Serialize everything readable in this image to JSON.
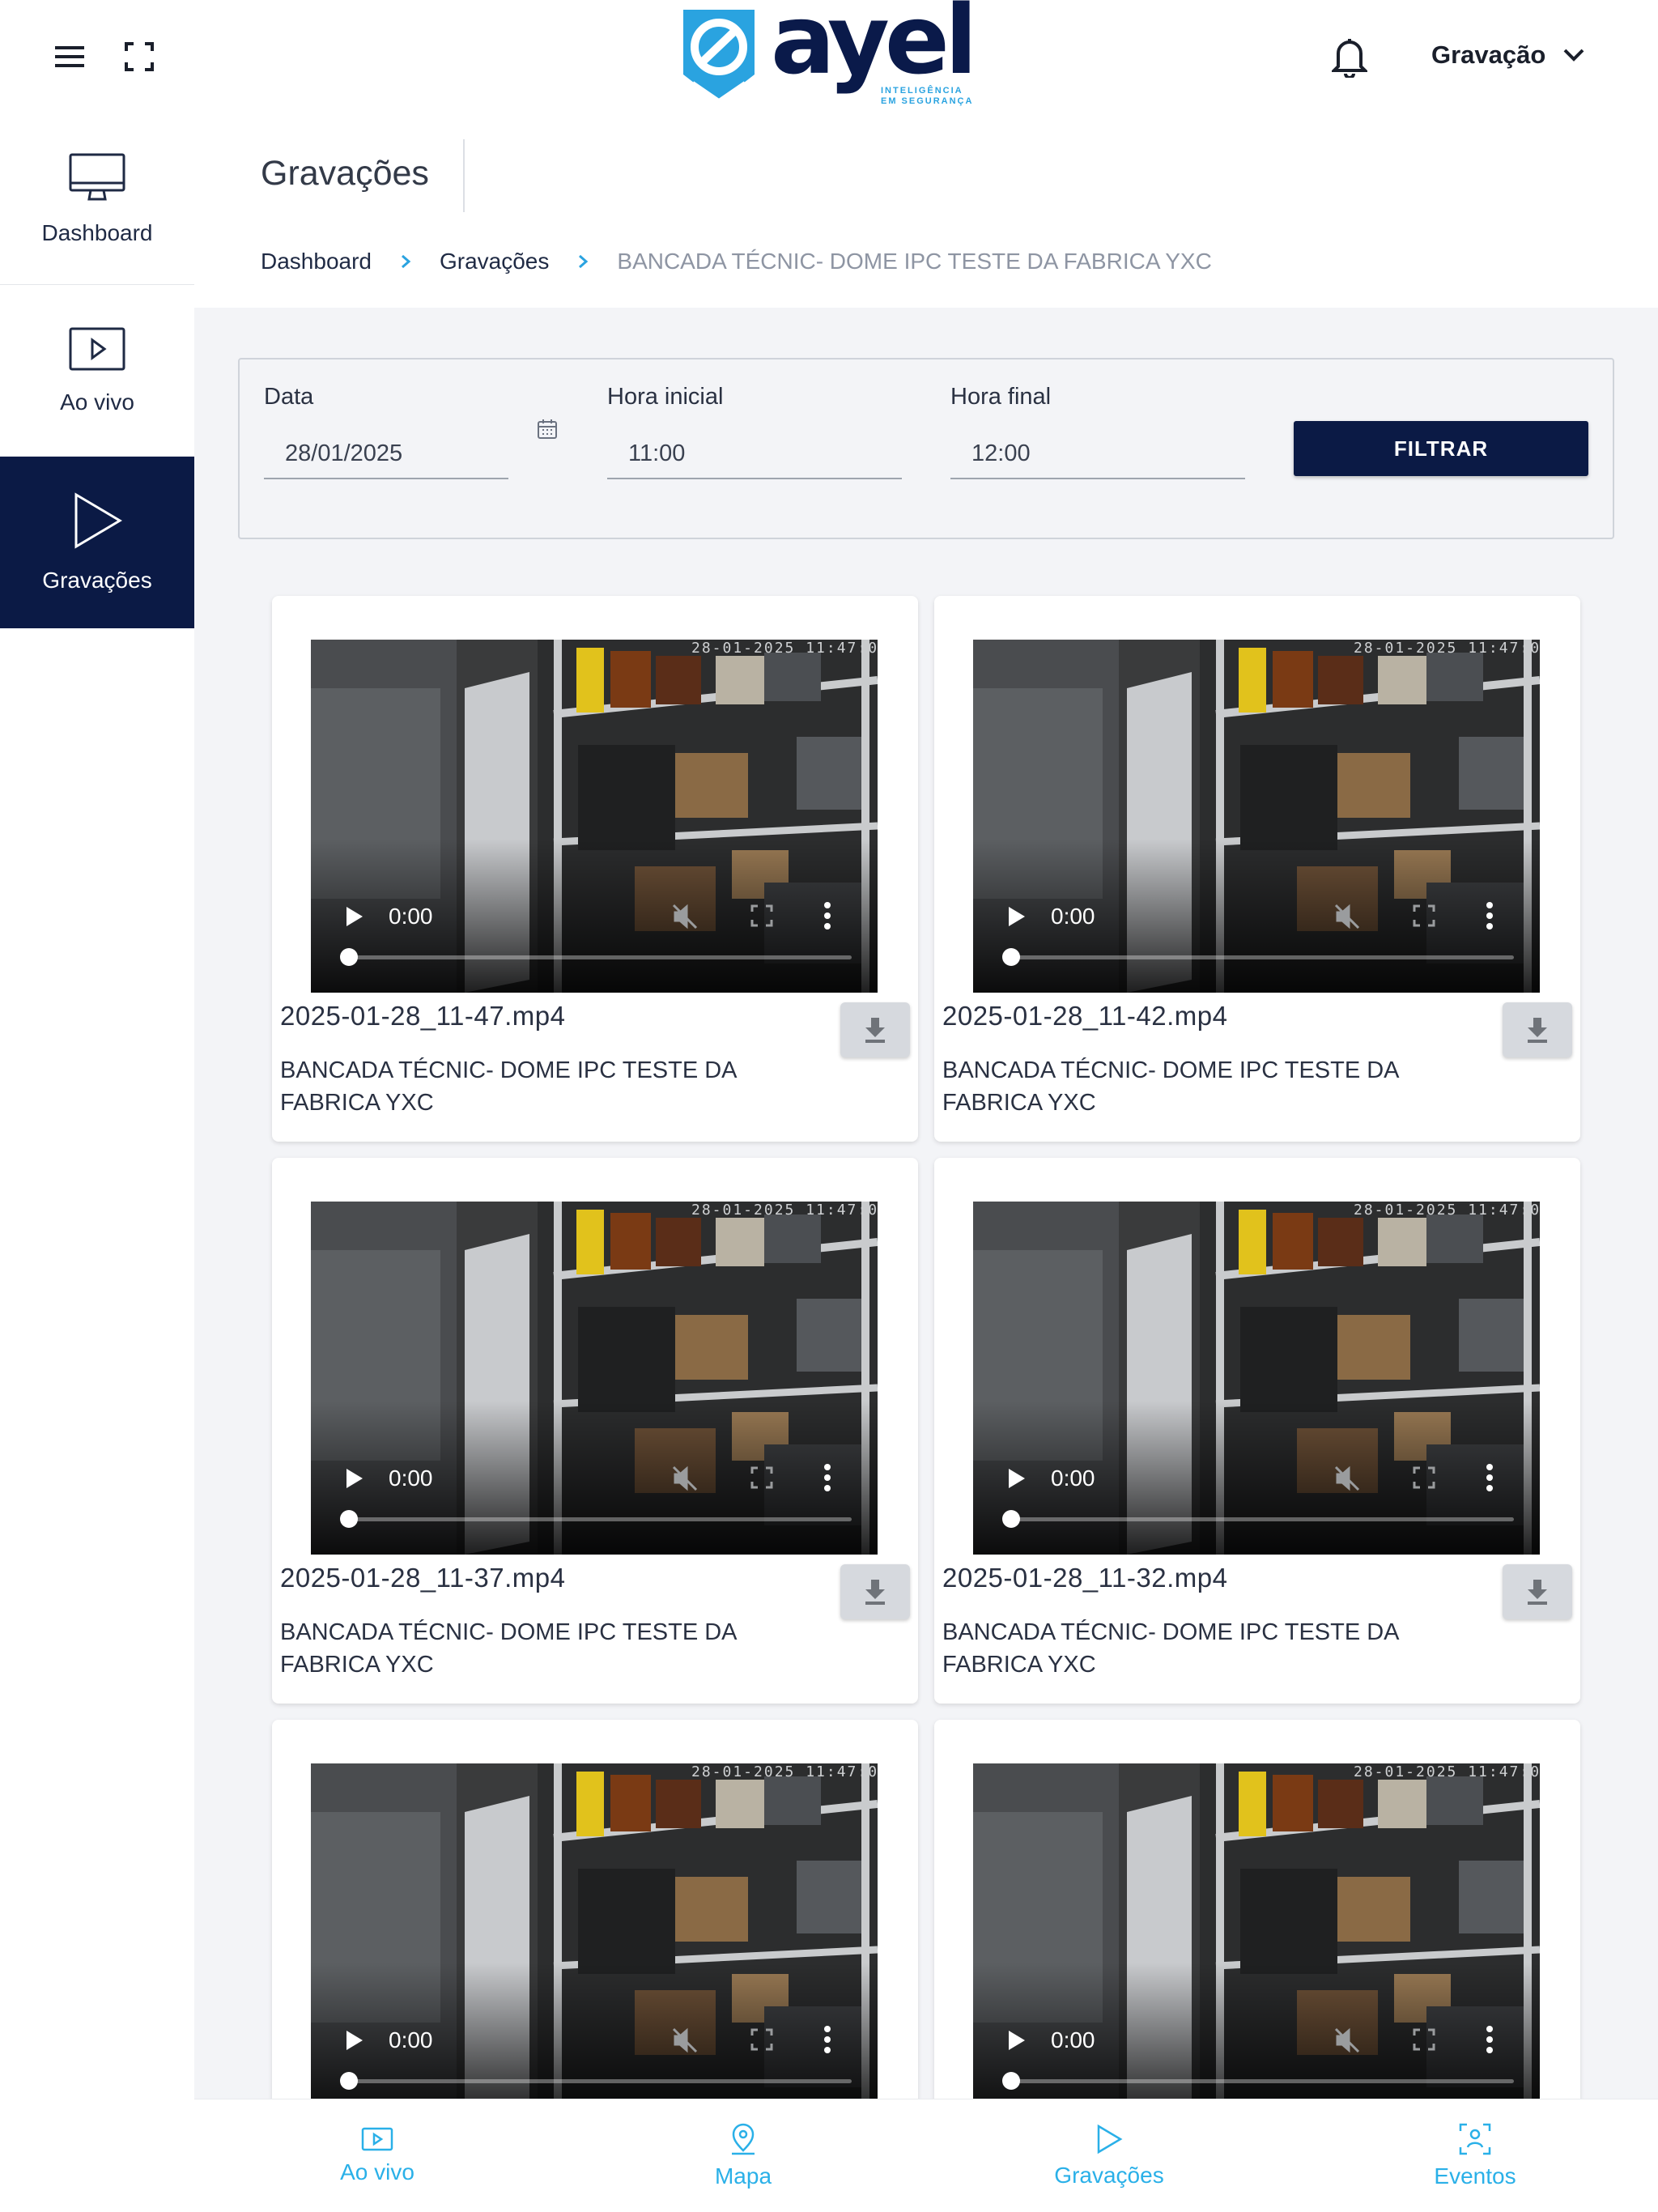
{
  "header": {
    "logo_text": "ayel",
    "logo_tagline_1": "INTELIGÊNCIA",
    "logo_tagline_2": "EM SEGURANÇA",
    "user_menu_label": "Gravação"
  },
  "sidebar": {
    "items": [
      {
        "label": "Dashboard",
        "icon": "monitor-icon",
        "active": false
      },
      {
        "label": "Ao vivo",
        "icon": "play-square-icon",
        "active": false
      },
      {
        "label": "Gravações",
        "icon": "play-icon",
        "active": true
      }
    ]
  },
  "page": {
    "title": "Gravações",
    "breadcrumb": [
      "Dashboard",
      "Gravações",
      "BANCADA TÉCNIC- DOME IPC TESTE DA FABRICA YXC"
    ]
  },
  "filter": {
    "date_label": "Data",
    "date_value": "28/01/2025",
    "start_label": "Hora inicial",
    "start_value": "11:00",
    "end_label": "Hora final",
    "end_value": "12:00",
    "button_label": "FILTRAR"
  },
  "recordings": [
    {
      "file": "2025-01-28_11-47.mp4",
      "camera": "BANCADA TÉCNIC- DOME IPC TESTE DA FABRICA YXC",
      "time": "0:00"
    },
    {
      "file": "2025-01-28_11-42.mp4",
      "camera": "BANCADA TÉCNIC- DOME IPC TESTE DA FABRICA YXC",
      "time": "0:00"
    },
    {
      "file": "2025-01-28_11-37.mp4",
      "camera": "BANCADA TÉCNIC- DOME IPC TESTE DA FABRICA YXC",
      "time": "0:00"
    },
    {
      "file": "2025-01-28_11-32.mp4",
      "camera": "BANCADA TÉCNIC- DOME IPC TESTE DA FABRICA YXC",
      "time": "0:00"
    },
    {
      "file": "",
      "camera": "",
      "time": "0:00"
    },
    {
      "file": "",
      "camera": "",
      "time": "0:00"
    }
  ],
  "bottom_nav": [
    {
      "label": "Ao vivo",
      "icon": "play-square-icon"
    },
    {
      "label": "Mapa",
      "icon": "map-pin-icon"
    },
    {
      "label": "Gravações",
      "icon": "play-icon"
    },
    {
      "label": "Eventos",
      "icon": "face-scan-icon"
    }
  ],
  "colors": {
    "primary": "#0b1a45",
    "accent": "#2ab0e8",
    "background": "#f3f4f7"
  }
}
